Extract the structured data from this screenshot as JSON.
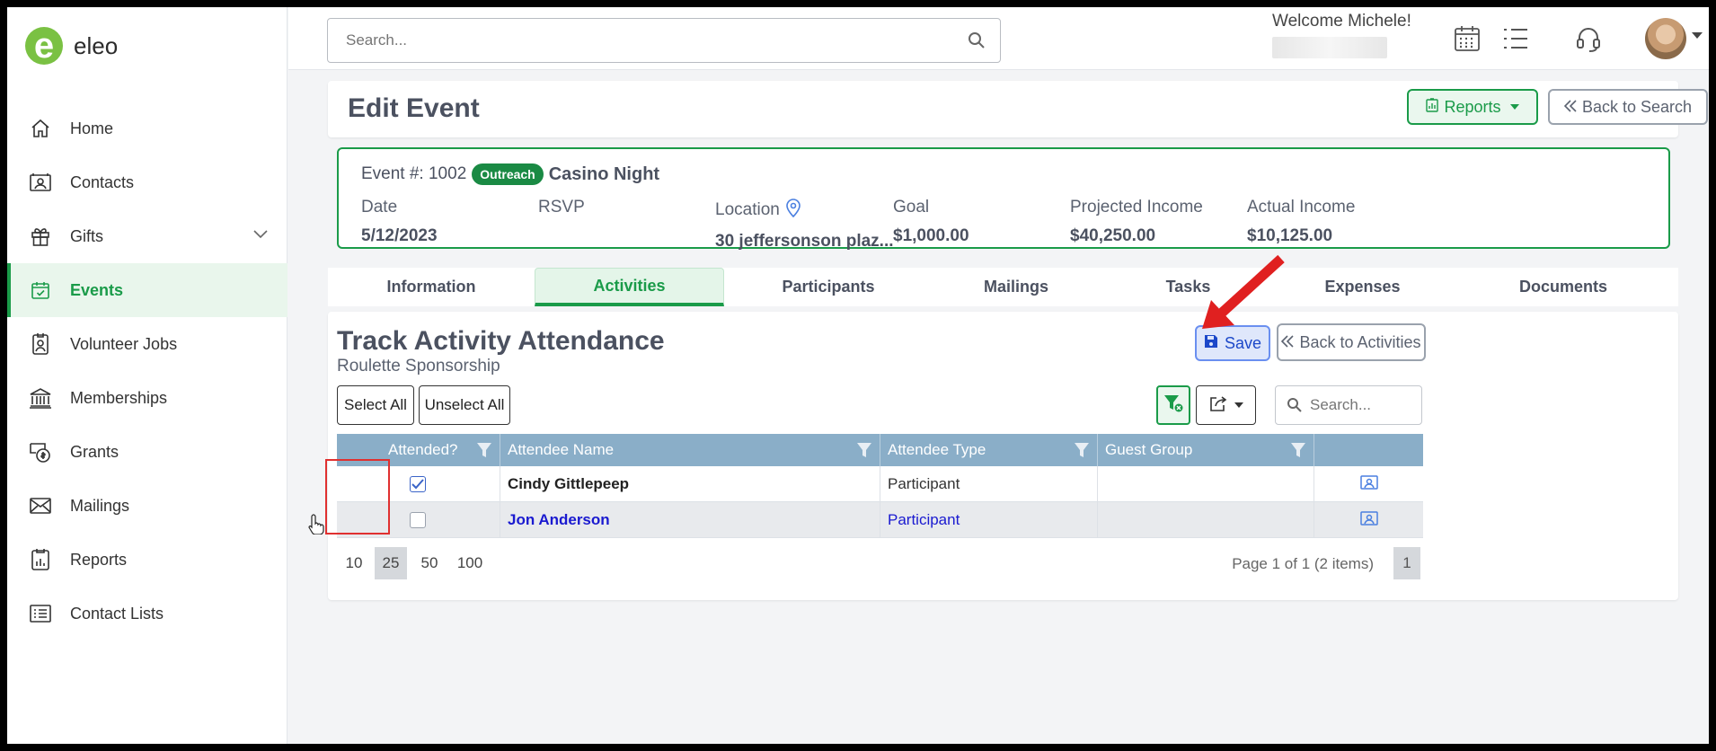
{
  "brand": {
    "name": "eleo",
    "logo_letter": "e",
    "color": "#7ac143"
  },
  "sidebar": {
    "items": [
      {
        "label": "Home",
        "icon": "home-icon"
      },
      {
        "label": "Contacts",
        "icon": "contacts-icon"
      },
      {
        "label": "Gifts",
        "icon": "gift-icon",
        "has_children": true
      },
      {
        "label": "Events",
        "icon": "calendar-check-icon",
        "active": true
      },
      {
        "label": "Volunteer Jobs",
        "icon": "badge-icon"
      },
      {
        "label": "Memberships",
        "icon": "institution-icon"
      },
      {
        "label": "Grants",
        "icon": "money-icon"
      },
      {
        "label": "Mailings",
        "icon": "envelope-icon"
      },
      {
        "label": "Reports",
        "icon": "report-icon"
      },
      {
        "label": "Contact Lists",
        "icon": "list-icon"
      }
    ]
  },
  "topbar": {
    "search_placeholder": "Search...",
    "welcome": "Welcome Michele!"
  },
  "page": {
    "title": "Edit Event",
    "reports_label": "Reports",
    "back_search_label": "Back to Search"
  },
  "event": {
    "number_label": "Event #: 1002",
    "badge": "Outreach",
    "name": "Casino Night",
    "fields": [
      {
        "label": "Date",
        "value": "5/12/2023"
      },
      {
        "label": "RSVP",
        "value": ""
      },
      {
        "label": "Location",
        "value": "30 jeffersonson plaz..."
      },
      {
        "label": "Goal",
        "value": "$1,000.00"
      },
      {
        "label": "Projected Income",
        "value": "$40,250.00"
      },
      {
        "label": "Actual Income",
        "value": "$10,125.00"
      }
    ]
  },
  "tabs": [
    {
      "label": "Information"
    },
    {
      "label": "Activities",
      "active": true
    },
    {
      "label": "Participants"
    },
    {
      "label": "Mailings"
    },
    {
      "label": "Tasks"
    },
    {
      "label": "Expenses"
    },
    {
      "label": "Documents"
    }
  ],
  "attendance": {
    "title": "Track Activity Attendance",
    "subtitle": "Roulette Sponsorship",
    "save_label": "Save",
    "back_activities_label": "Back to Activities",
    "select_all_label": "Select All",
    "unselect_all_label": "Unselect All",
    "search_placeholder": "Search...",
    "columns": [
      "Attended?",
      "Attendee Name",
      "Attendee Type",
      "Guest Group"
    ],
    "rows": [
      {
        "attended": true,
        "name": "Cindy Gittlepeep",
        "type": "Participant",
        "guest_group": ""
      },
      {
        "attended": false,
        "name": "Jon Anderson",
        "type": "Participant",
        "guest_group": ""
      }
    ],
    "page_sizes": [
      "10",
      "25",
      "50",
      "100"
    ],
    "page_size_active": "25",
    "page_info": "Page 1 of 1 (2 items)",
    "current_page": "1"
  },
  "colors": {
    "accent": "#1a9b49",
    "grid_header": "#8aaec8",
    "link": "#1a1ad0",
    "annotation": "#e03030"
  }
}
